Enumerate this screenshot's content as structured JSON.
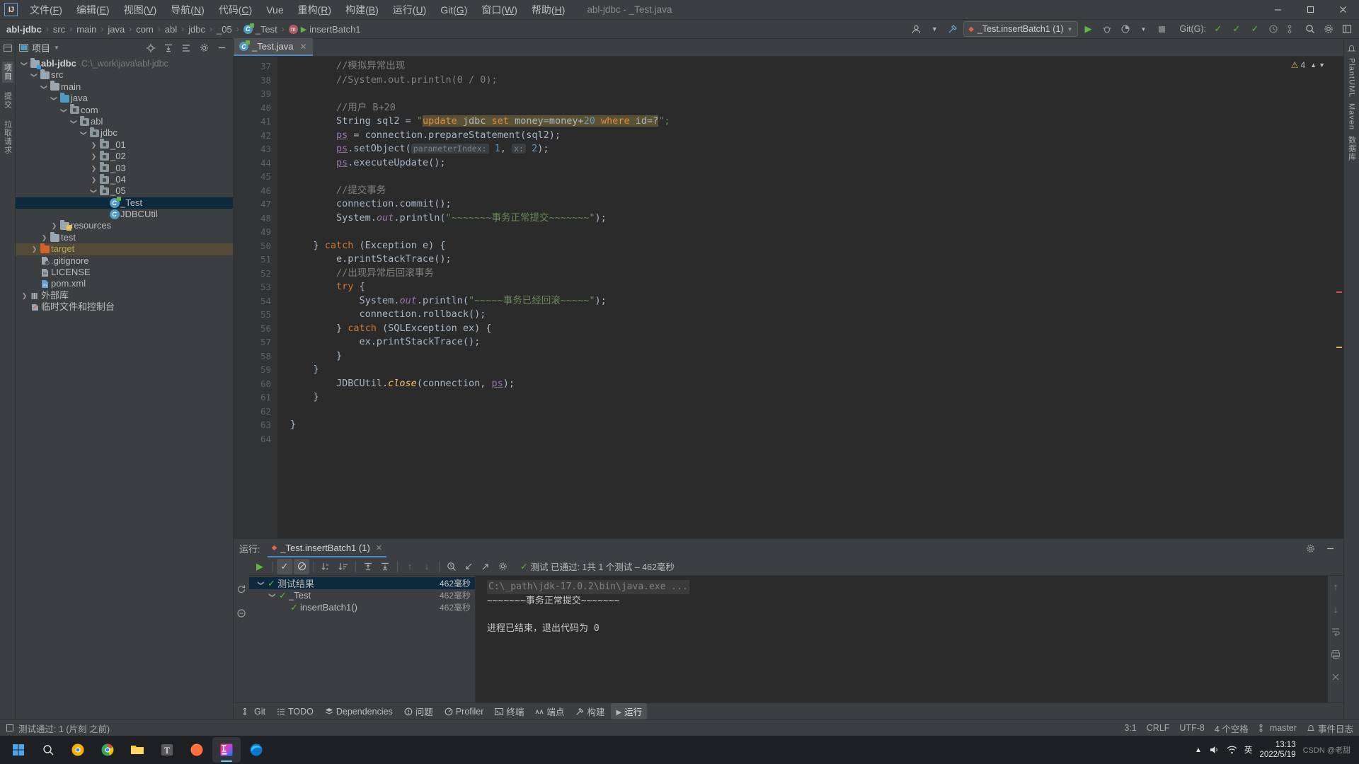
{
  "window": {
    "title": "abl-jdbc - _Test.java",
    "logo": "IJ",
    "controls": {
      "minimize": "—",
      "maximize": "☐",
      "close": "✕"
    }
  },
  "menu": [
    {
      "label": "文件",
      "mnemonic": "F"
    },
    {
      "label": "编辑",
      "mnemonic": "E"
    },
    {
      "label": "视图",
      "mnemonic": "V"
    },
    {
      "label": "导航",
      "mnemonic": "N"
    },
    {
      "label": "代码",
      "mnemonic": "C"
    },
    {
      "label": "Vue",
      "mnemonic": ""
    },
    {
      "label": "重构",
      "mnemonic": "R"
    },
    {
      "label": "构建",
      "mnemonic": "B"
    },
    {
      "label": "运行",
      "mnemonic": "U"
    },
    {
      "label": "Git",
      "mnemonic": "G"
    },
    {
      "label": "窗口",
      "mnemonic": "W"
    },
    {
      "label": "帮助",
      "mnemonic": "H"
    }
  ],
  "breadcrumb": {
    "items": [
      "abl-jdbc",
      "src",
      "main",
      "java",
      "com",
      "abl",
      "jdbc",
      "_05",
      "_Test",
      "insertBatch1"
    ],
    "separator": "›"
  },
  "navbar": {
    "run_config": "_Test.insertBatch1 (1)",
    "git_label": "Git(G):",
    "search_icon": "search-icon",
    "settings_icon": "gear-icon"
  },
  "project": {
    "panel_title": "项目",
    "tree": [
      {
        "depth": 0,
        "label": "abl-jdbc",
        "path": "C:\\_work\\java\\abl-jdbc",
        "icon": "folder-module",
        "arrow": "expanded",
        "style": "bold"
      },
      {
        "depth": 1,
        "label": "src",
        "icon": "folder",
        "arrow": "expanded"
      },
      {
        "depth": 2,
        "label": "main",
        "icon": "folder",
        "arrow": "expanded"
      },
      {
        "depth": 3,
        "label": "java",
        "icon": "folder-source",
        "arrow": "expanded"
      },
      {
        "depth": 4,
        "label": "com",
        "icon": "folder-package",
        "arrow": "expanded"
      },
      {
        "depth": 5,
        "label": "abl",
        "icon": "folder-package",
        "arrow": "expanded"
      },
      {
        "depth": 6,
        "label": "jdbc",
        "icon": "folder-package",
        "arrow": "expanded"
      },
      {
        "depth": 7,
        "label": "_01",
        "icon": "folder-package",
        "arrow": "collapsed"
      },
      {
        "depth": 7,
        "label": "_02",
        "icon": "folder-package",
        "arrow": "collapsed"
      },
      {
        "depth": 7,
        "label": "_03",
        "icon": "folder-package",
        "arrow": "collapsed"
      },
      {
        "depth": 7,
        "label": "_04",
        "icon": "folder-package",
        "arrow": "collapsed"
      },
      {
        "depth": 7,
        "label": "_05",
        "icon": "folder-package",
        "arrow": "expanded"
      },
      {
        "depth": 8,
        "label": "_Test",
        "icon": "class-runnable",
        "arrow": "none",
        "state": "selected"
      },
      {
        "depth": 8,
        "label": "JDBCUtil",
        "icon": "class",
        "arrow": "none"
      },
      {
        "depth": 3,
        "label": "resources",
        "icon": "folder-resources",
        "arrow": "collapsed"
      },
      {
        "depth": 2,
        "label": "test",
        "icon": "folder",
        "arrow": "collapsed"
      },
      {
        "depth": 1,
        "label": "target",
        "icon": "folder-excluded",
        "arrow": "collapsed",
        "state": "highlight"
      },
      {
        "depth": 1,
        "label": ".gitignore",
        "icon": "file-git",
        "arrow": "none"
      },
      {
        "depth": 1,
        "label": "LICENSE",
        "icon": "file-text",
        "arrow": "none"
      },
      {
        "depth": 1,
        "label": "pom.xml",
        "icon": "file-maven",
        "arrow": "none"
      },
      {
        "depth": 0,
        "label": "外部库",
        "icon": "library",
        "arrow": "collapsed"
      },
      {
        "depth": 0,
        "label": "临时文件和控制台",
        "icon": "scratches",
        "arrow": "none"
      }
    ]
  },
  "editor": {
    "tab": {
      "label": "_Test.java",
      "icon": "java-class-runnable-icon",
      "close": "✕"
    },
    "inspection_count": "4",
    "inspection_icon": "warning-icon",
    "first_line": 37,
    "lines": [
      {
        "n": 37,
        "fold": "end",
        "tokens": [
          {
            "t": "        ",
            "c": "plain"
          },
          {
            "t": "//模拟异常出现",
            "c": "cmt"
          }
        ]
      },
      {
        "n": 38,
        "tokens": [
          {
            "t": "        ",
            "c": "plain"
          },
          {
            "t": "//System.out.println(0 / 0);",
            "c": "cmt"
          }
        ]
      },
      {
        "n": 39,
        "tokens": []
      },
      {
        "n": 40,
        "fold": "start",
        "tokens": [
          {
            "t": "        ",
            "c": "plain"
          },
          {
            "t": "//用户 B+20",
            "c": "cmt"
          }
        ]
      },
      {
        "n": 41,
        "tokens": [
          {
            "t": "        ",
            "c": "plain"
          },
          {
            "t": "String",
            "c": "plain"
          },
          {
            "t": " sql2 = ",
            "c": "plain"
          },
          {
            "t": "\"",
            "c": "str"
          },
          {
            "t": "SQLHL",
            "c": "sqlblock"
          },
          {
            "t": "\";",
            "c": "str"
          }
        ]
      },
      {
        "n": 42,
        "tokens": [
          {
            "t": "        ",
            "c": "plain"
          },
          {
            "t": "ps",
            "c": "fld-u"
          },
          {
            "t": " = connection.prepareStatement(sql2);",
            "c": "plain"
          }
        ]
      },
      {
        "n": 43,
        "tokens": [
          {
            "t": "        ",
            "c": "plain"
          },
          {
            "t": "ps",
            "c": "fld-u"
          },
          {
            "t": ".setObject(",
            "c": "plain"
          },
          {
            "t": "HINT1",
            "c": "hintblock"
          },
          {
            "t": " ",
            "c": "plain"
          },
          {
            "t": "1",
            "c": "num"
          },
          {
            "t": ", ",
            "c": "plain"
          },
          {
            "t": "HINT2",
            "c": "hintblock"
          },
          {
            "t": " ",
            "c": "plain"
          },
          {
            "t": "2",
            "c": "num"
          },
          {
            "t": ");",
            "c": "plain"
          }
        ]
      },
      {
        "n": 44,
        "tokens": [
          {
            "t": "        ",
            "c": "plain"
          },
          {
            "t": "ps",
            "c": "fld-u"
          },
          {
            "t": ".executeUpdate();",
            "c": "plain"
          }
        ]
      },
      {
        "n": 45,
        "tokens": []
      },
      {
        "n": 46,
        "tokens": [
          {
            "t": "        ",
            "c": "plain"
          },
          {
            "t": "//提交事务",
            "c": "cmt"
          }
        ]
      },
      {
        "n": 47,
        "tokens": [
          {
            "t": "        ",
            "c": "plain"
          },
          {
            "t": "connection.commit();",
            "c": "plain"
          }
        ]
      },
      {
        "n": 48,
        "tokens": [
          {
            "t": "        ",
            "c": "plain"
          },
          {
            "t": "System.",
            "c": "plain"
          },
          {
            "t": "out",
            "c": "fld-i"
          },
          {
            "t": ".println(",
            "c": "plain"
          },
          {
            "t": "\"~~~~~~~事务正常提交~~~~~~~\"",
            "c": "str"
          },
          {
            "t": ");",
            "c": "plain"
          }
        ]
      },
      {
        "n": 49,
        "tokens": []
      },
      {
        "n": 50,
        "fold": "end",
        "tokens": [
          {
            "t": "    } ",
            "c": "plain"
          },
          {
            "t": "catch",
            "c": "kw"
          },
          {
            "t": " (Exception e) {",
            "c": "plain"
          }
        ]
      },
      {
        "n": 51,
        "tokens": [
          {
            "t": "        e.printStackTrace();",
            "c": "plain"
          }
        ]
      },
      {
        "n": 52,
        "tokens": [
          {
            "t": "        ",
            "c": "plain"
          },
          {
            "t": "//出现异常后回滚事务",
            "c": "cmt"
          }
        ]
      },
      {
        "n": 53,
        "fold": "start",
        "tokens": [
          {
            "t": "        ",
            "c": "plain"
          },
          {
            "t": "try",
            "c": "kw"
          },
          {
            "t": " {",
            "c": "plain"
          }
        ]
      },
      {
        "n": 54,
        "tokens": [
          {
            "t": "            System.",
            "c": "plain"
          },
          {
            "t": "out",
            "c": "fld-i"
          },
          {
            "t": ".println(",
            "c": "plain"
          },
          {
            "t": "\"~~~~~事务已经回滚~~~~~\"",
            "c": "str"
          },
          {
            "t": ");",
            "c": "plain"
          }
        ]
      },
      {
        "n": 55,
        "tokens": [
          {
            "t": "            connection.rollback();",
            "c": "plain"
          }
        ]
      },
      {
        "n": 56,
        "fold": "end",
        "tokens": [
          {
            "t": "        } ",
            "c": "plain"
          },
          {
            "t": "catch",
            "c": "kw"
          },
          {
            "t": " (SQLException ex) {",
            "c": "plain"
          }
        ]
      },
      {
        "n": 57,
        "tokens": [
          {
            "t": "            ex.printStackTrace();",
            "c": "plain"
          }
        ]
      },
      {
        "n": 58,
        "fold": "end",
        "tokens": [
          {
            "t": "        }",
            "c": "plain"
          }
        ]
      },
      {
        "n": 59,
        "fold": "end",
        "tokens": [
          {
            "t": "    }",
            "c": "plain"
          }
        ]
      },
      {
        "n": 60,
        "tokens": [
          {
            "t": "        JDBCUtil.",
            "c": "plain"
          },
          {
            "t": "close",
            "c": "mth-i"
          },
          {
            "t": "(connection, ",
            "c": "plain"
          },
          {
            "t": "ps",
            "c": "fld-u"
          },
          {
            "t": ");",
            "c": "plain"
          }
        ]
      },
      {
        "n": 61,
        "fold": "end",
        "tokens": [
          {
            "t": "    }",
            "c": "plain"
          }
        ]
      },
      {
        "n": 62,
        "tokens": []
      },
      {
        "n": 63,
        "tokens": [
          {
            "t": "}",
            "c": "plain"
          }
        ]
      },
      {
        "n": 64,
        "tokens": []
      }
    ],
    "sql_string": {
      "full": "update jdbc set money=money+20 where id=?",
      "parts": [
        {
          "t": "update",
          "c": "sql-kw"
        },
        {
          "t": " jdbc ",
          "c": "sql-id"
        },
        {
          "t": "set",
          "c": "sql-kw"
        },
        {
          "t": " money=money+",
          "c": "sql-id"
        },
        {
          "t": "20",
          "c": "sql-num"
        },
        {
          "t": " ",
          "c": "sql-id"
        },
        {
          "t": "where",
          "c": "sql-kw"
        },
        {
          "t": " id=?",
          "c": "sql-id"
        }
      ]
    },
    "hints": {
      "hint1": "parameterIndex:",
      "hint2": "x:"
    }
  },
  "run_panel": {
    "label": "运行:",
    "tab": "_Test.insertBatch1 (1)",
    "tab_close": "✕",
    "status": "测试 已通过: 1共 1 个测试 – 462毫秒",
    "status_icon": "check-icon",
    "tree": [
      {
        "depth": 0,
        "label": "测试结果",
        "time": "462毫秒",
        "state": "selected",
        "arrow": "expanded",
        "icon": "check-icon"
      },
      {
        "depth": 1,
        "label": "_Test",
        "time": "462毫秒",
        "arrow": "expanded",
        "icon": "check-icon"
      },
      {
        "depth": 2,
        "label": "insertBatch1()",
        "time": "462毫秒",
        "arrow": "none",
        "icon": "check-icon"
      }
    ],
    "console": [
      {
        "text": "C:\\_path\\jdk-17.0.2\\bin\\java.exe ...",
        "style": "command"
      },
      {
        "text": "~~~~~~~事务正常提交~~~~~~~",
        "style": "output"
      },
      {
        "text": "",
        "style": "output"
      },
      {
        "text": "进程已结束，退出代码为 0",
        "style": "output"
      }
    ]
  },
  "tool_windows": [
    {
      "label": "Git",
      "icon": "git-icon"
    },
    {
      "label": "TODO",
      "icon": "todo-icon"
    },
    {
      "label": "Dependencies",
      "icon": "dependencies-icon"
    },
    {
      "label": "问题",
      "icon": "problems-icon"
    },
    {
      "label": "Profiler",
      "icon": "profiler-icon"
    },
    {
      "label": "终端",
      "icon": "terminal-icon"
    },
    {
      "label": "端点",
      "icon": "endpoints-icon"
    },
    {
      "label": "构建",
      "icon": "build-icon"
    },
    {
      "label": "运行",
      "icon": "run-icon",
      "active": true
    }
  ],
  "status_bar": {
    "message": "测试通过: 1 (片刻 之前)",
    "message_icon": "info-icon",
    "caret": "3:1",
    "line_sep": "CRLF",
    "encoding": "UTF-8",
    "indent": "4 个空格",
    "branch": "master",
    "branch_icon": "branch-icon",
    "event_log": "事件日志",
    "event_log_icon": "bell-icon"
  },
  "left_stripe": [
    "项目",
    "提交",
    "拉取请求"
  ],
  "right_stripe": [
    "PlantUML",
    "Maven",
    "数据库"
  ],
  "taskbar": {
    "start_icon": "windows-icon",
    "search_icon": "search-icon",
    "apps": [
      "chrome-canary-icon",
      "chrome-icon",
      "explorer-icon",
      "typora-icon",
      "firefox-icon",
      "intellij-icon",
      "edge-icon"
    ],
    "clock_time": "13:13",
    "clock_date": "2022/5/19",
    "tray": [
      "chevron-up-icon",
      "volume-icon",
      "network-icon"
    ],
    "ime": "英",
    "watermark": "CSDN @老甜"
  },
  "colors": {
    "accent": "#4a88c7",
    "selection": "#0d293e",
    "success": "#62b543",
    "warning": "#d4b85a",
    "editor_bg": "#2b2b2b",
    "panel_bg": "#3c3f41"
  }
}
